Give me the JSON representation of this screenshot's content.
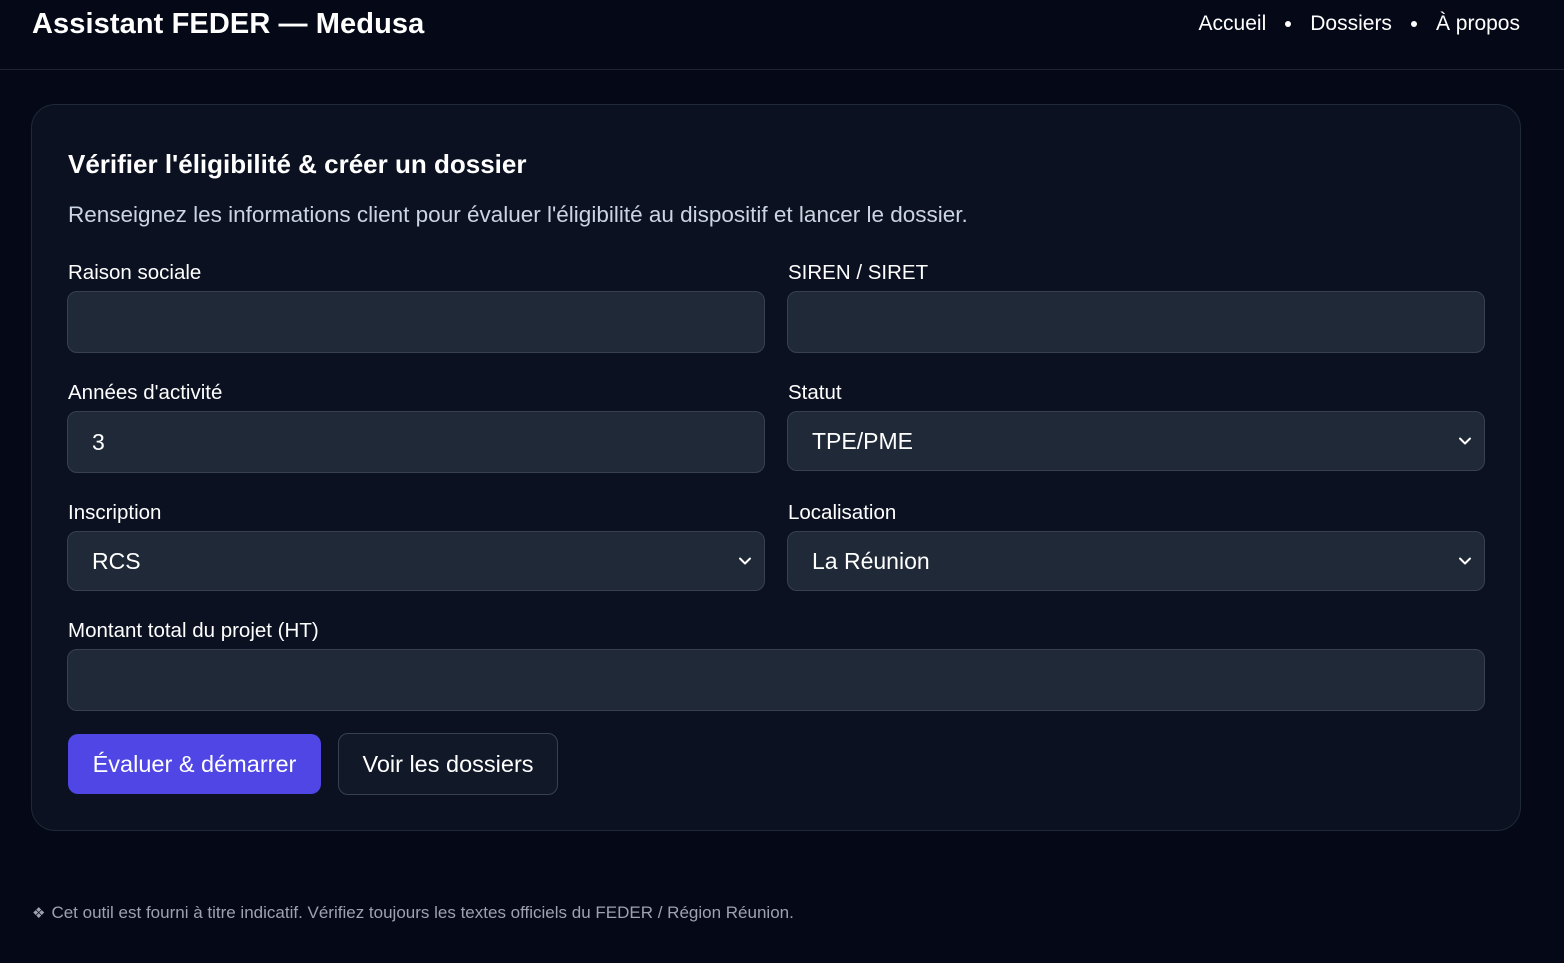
{
  "header": {
    "brand": "Assistant FEDER — Medusa",
    "nav": [
      {
        "label": "Accueil"
      },
      {
        "label": "Dossiers"
      },
      {
        "label": "À propos"
      }
    ]
  },
  "card": {
    "title": "Vérifier l'éligibilité & créer un dossier",
    "subtitle": "Renseignez les informations client pour évaluer l'éligibilité au dispositif et lancer le dossier.",
    "fields": {
      "raison_sociale": {
        "label": "Raison sociale",
        "value": ""
      },
      "siren": {
        "label": "SIREN / SIRET",
        "value": ""
      },
      "annees": {
        "label": "Années d'activité",
        "value": "3"
      },
      "statut": {
        "label": "Statut",
        "value": "TPE/PME"
      },
      "inscription": {
        "label": "Inscription",
        "value": "RCS"
      },
      "localisation": {
        "label": "Localisation",
        "value": "La Réunion"
      },
      "montant": {
        "label": "Montant total du projet (HT)",
        "value": ""
      }
    },
    "buttons": {
      "primary": "Évaluer & démarrer",
      "secondary": "Voir les dossiers"
    }
  },
  "footer": {
    "icon": "diamond-icon",
    "text": "Cet outil est fourni à titre indicatif. Vérifiez toujours les textes officiels du FEDER / Région Réunion."
  },
  "colors": {
    "background": "#050816",
    "card": "#0b1120",
    "field": "#1f2937",
    "accent": "#4f46e5"
  }
}
